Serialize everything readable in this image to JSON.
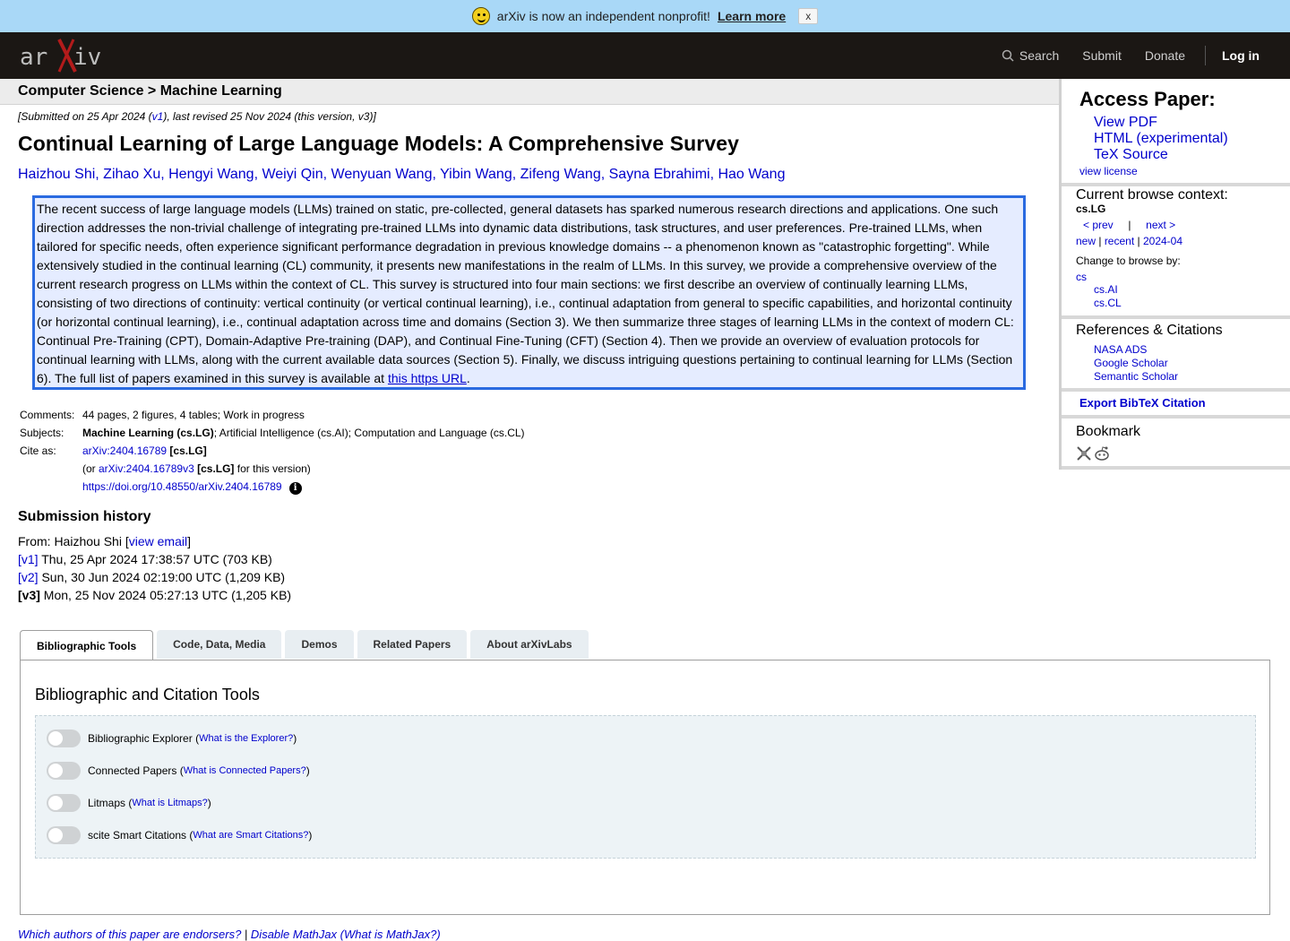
{
  "banner": {
    "message": "arXiv is now an independent nonprofit!",
    "learn_more": "Learn more",
    "close": "x"
  },
  "header": {
    "logo_text": "arXiv",
    "search": "Search",
    "submit": "Submit",
    "donate": "Donate",
    "login": "Log in"
  },
  "breadcrumb": "Computer Science > Machine Learning",
  "paper": {
    "dateline_prefix": "[Submitted on 25 Apr 2024 (",
    "dateline_v1": "v1",
    "dateline_suffix": "), last revised 25 Nov 2024 (this version, v3)]",
    "title": "Continual Learning of Large Language Models: A Comprehensive Survey",
    "authors": [
      "Haizhou Shi",
      "Zihao Xu",
      "Hengyi Wang",
      "Weiyi Qin",
      "Wenyuan Wang",
      "Yibin Wang",
      "Zifeng Wang",
      "Sayna Ebrahimi",
      "Hao Wang"
    ],
    "abstract": "The recent success of large language models (LLMs) trained on static, pre-collected, general datasets has sparked numerous research directions and applications. One such direction addresses the non-trivial challenge of integrating pre-trained LLMs into dynamic data distributions, task structures, and user preferences. Pre-trained LLMs, when tailored for specific needs, often experience significant performance degradation in previous knowledge domains -- a phenomenon known as \"catastrophic forgetting\". While extensively studied in the continual learning (CL) community, it presents new manifestations in the realm of LLMs. In this survey, we provide a comprehensive overview of the current research progress on LLMs within the context of CL. This survey is structured into four main sections: we first describe an overview of continually learning LLMs, consisting of two directions of continuity: vertical continuity (or vertical continual learning), i.e., continual adaptation from general to specific capabilities, and horizontal continuity (or horizontal continual learning), i.e., continual adaptation across time and domains (Section 3). We then summarize three stages of learning LLMs in the context of modern CL: Continual Pre-Training (CPT), Domain-Adaptive Pre-training (DAP), and Continual Fine-Tuning (CFT) (Section 4). Then we provide an overview of evaluation protocols for continual learning with LLMs, along with the current available data sources (Section 5). Finally, we discuss intriguing questions pertaining to continual learning for LLMs (Section 6). The full list of papers examined in this survey is available at ",
    "abstract_link": "this https URL",
    "abstract_end": "."
  },
  "meta": {
    "comments_label": "Comments:",
    "comments": "44 pages, 2 figures, 4 tables; Work in progress",
    "subjects_label": "Subjects:",
    "subjects_primary": "Machine Learning (cs.LG)",
    "subjects_rest": "; Artificial Intelligence (cs.AI); Computation and Language (cs.CL)",
    "cite_label": "Cite as:",
    "cite_id": "arXiv:2404.16789",
    "cite_cat": "[cs.LG]",
    "cite_or": "(or ",
    "cite_version_id": "arXiv:2404.16789v3",
    "cite_version_cat": "[cs.LG]",
    "cite_version_suffix": " for this version)",
    "doi": "https://doi.org/10.48550/arXiv.2404.16789",
    "doi_icon": "i"
  },
  "history": {
    "heading": "Submission history",
    "from_prefix": "From: Haizhou Shi [",
    "view_email": "view email",
    "from_suffix": "]",
    "versions": [
      {
        "tag": "[v1]",
        "text": " Thu, 25 Apr 2024 17:38:57 UTC (703 KB)"
      },
      {
        "tag": "[v2]",
        "text": " Sun, 30 Jun 2024 02:19:00 UTC (1,209 KB)"
      },
      {
        "tag": "[v3]",
        "text": " Mon, 25 Nov 2024 05:27:13 UTC (1,205 KB)"
      }
    ]
  },
  "tabs": {
    "items": [
      "Bibliographic Tools",
      "Code, Data, Media",
      "Demos",
      "Related Papers",
      "About arXivLabs"
    ],
    "panel_title": "Bibliographic and Citation Tools",
    "toggles": [
      {
        "label": "Bibliographic Explorer",
        "help": "What is the Explorer?"
      },
      {
        "label": "Connected Papers",
        "help": "What is Connected Papers?"
      },
      {
        "label": "Litmaps",
        "help": "What is Litmaps?"
      },
      {
        "label": "scite Smart Citations",
        "help": "What are Smart Citations?"
      }
    ]
  },
  "footer": {
    "endorsers": "Which authors of this paper are endorsers?",
    "sep": " | ",
    "disable": "Disable MathJax",
    "what": "What is MathJax?"
  },
  "sidebar": {
    "access_heading": "Access Paper:",
    "view_pdf": "View PDF",
    "html": "HTML (experimental)",
    "tex": "TeX Source",
    "license": "view license",
    "context_heading": "Current browse context:",
    "context_cat": "cs.LG",
    "prev": "< prev",
    "pipe": "|",
    "next": "next >",
    "new": "new",
    "recent": "recent",
    "month": "2024-04",
    "change_browse": "Change to browse by:",
    "browse_cs": "cs",
    "browse_ai": "cs.AI",
    "browse_cl": "cs.CL",
    "refs_heading": "References & Citations",
    "nasa": "NASA ADS",
    "scholar": "Google Scholar",
    "semantic": "Semantic Scholar",
    "export": "Export BibTeX Citation",
    "bookmark": "Bookmark"
  }
}
